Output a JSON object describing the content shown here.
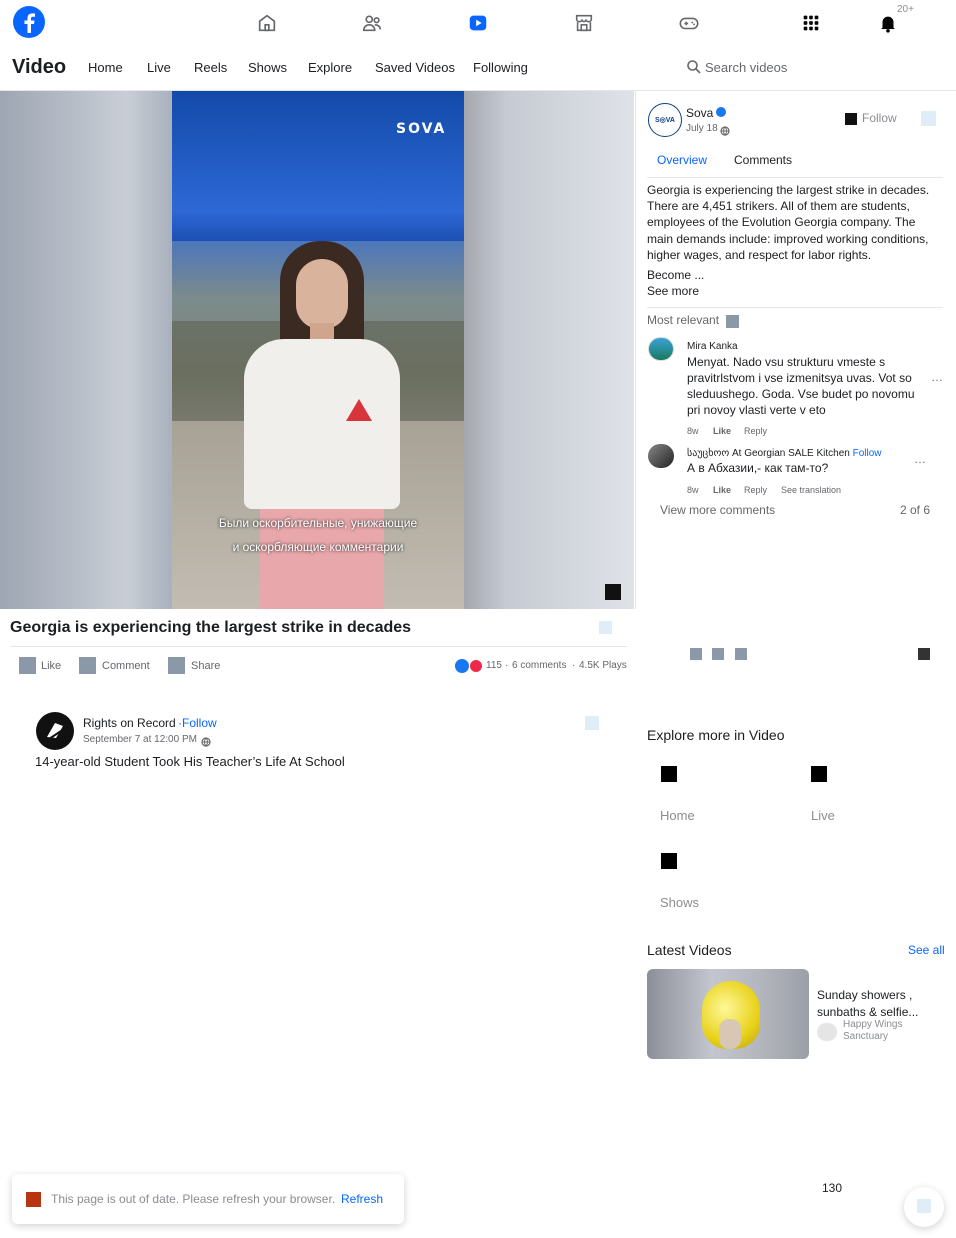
{
  "topbar": {
    "notification_badge": "20+",
    "icons": [
      "facebook-logo",
      "home-icon",
      "friends-icon",
      "video-icon",
      "marketplace-icon",
      "gaming-icon",
      "menu-grid-icon",
      "bell-icon"
    ]
  },
  "nav": {
    "title": "Video",
    "links": [
      "Home",
      "Live",
      "Reels",
      "Shows",
      "Explore",
      "Saved Videos",
      "Following"
    ],
    "search_placeholder": "Search videos"
  },
  "video": {
    "watermark": "SOVA",
    "caption_line1": "Были оскорбительные, унижающие",
    "caption_line2": "и оскорбляющие комментарии"
  },
  "post": {
    "title": "Georgia is experiencing the largest strike in decades",
    "actions": {
      "like": "Like",
      "comment": "Comment",
      "share": "Share"
    },
    "reaction_count": "115",
    "comments_count": "6 comments",
    "plays": "4.5K Plays"
  },
  "next_video": {
    "author": "Rights on Record",
    "follow": "Follow",
    "date": "September 7 at 12:00 PM",
    "title": "14-year-old Student Took His Teacher’s Life At School"
  },
  "sidebar": {
    "page_name": "Sova",
    "date": "July 18",
    "follow": "Follow",
    "tabs": [
      "Overview",
      "Comments"
    ],
    "description": "Georgia is experiencing the largest strike in decades. There are 4,451 strikers. All of them are students, employees of the Evolution Georgia company. The main demands include: improved working conditions, higher wages, and respect for labor rights.",
    "description_more": "Become ...",
    "see_more": "See more",
    "sort_label": "Most relevant",
    "comments": [
      {
        "author": "Mira Kanka",
        "text": "Menyat. Nado vsu strukturu vmeste s pravitrlstvom i vse izmenitsya uvas. Vot so sleduushego. Goda. Vse budet po novomu pri novoy vlasti verte v eto",
        "time": "8w",
        "like": "Like",
        "reply": "Reply"
      },
      {
        "author": "საუცხოო At Georgian SALE Kitchen",
        "follow": "Follow",
        "text": "А в Абхазии,- как там-то?",
        "time": "8w",
        "like": "Like",
        "reply": "Reply",
        "translate": "See translation"
      }
    ],
    "view_more": "View more comments",
    "pager": "2 of 6"
  },
  "explore": {
    "heading": "Explore more in Video",
    "items": [
      "Home",
      "Live",
      "Shows"
    ]
  },
  "latest": {
    "heading": "Latest Videos",
    "see_all": "See all",
    "video_title": "Sunday showers , sunbaths & selfie...",
    "channel": "Happy Wings Sanctuary"
  },
  "toast": {
    "message": "This page is out of date. Please refresh your browser.",
    "action": "Refresh"
  },
  "counter": "130",
  "colors": {
    "brand": "#0866ff",
    "accent_toast": "#b8360f"
  }
}
